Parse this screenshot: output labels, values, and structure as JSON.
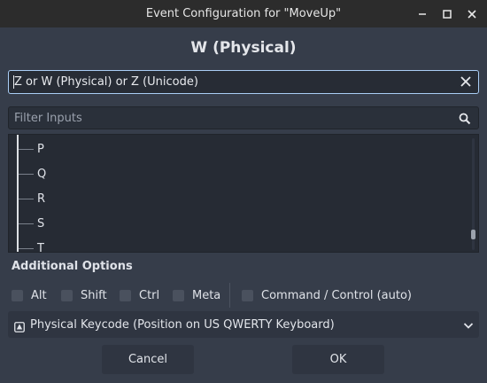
{
  "window": {
    "title": "Event Configuration for \"MoveUp\""
  },
  "heading": "W (Physical)",
  "event_field": {
    "value": "Z or W (Physical) or Z (Unicode)"
  },
  "filter": {
    "placeholder": "Filter Inputs"
  },
  "tree": {
    "items": [
      "P",
      "Q",
      "R",
      "S",
      "T"
    ]
  },
  "options": {
    "heading": "Additional Options",
    "modifiers": [
      {
        "label": "Alt",
        "checked": false
      },
      {
        "label": "Shift",
        "checked": false
      },
      {
        "label": "Ctrl",
        "checked": false
      },
      {
        "label": "Meta",
        "checked": false
      }
    ],
    "command_control": {
      "label": "Command / Control (auto)",
      "checked": false
    }
  },
  "keycode_select": {
    "selected": "Physical Keycode (Position on US QWERTY Keyboard)",
    "icon": "keyboard-physical-icon"
  },
  "buttons": {
    "cancel": "Cancel",
    "ok": "OK"
  },
  "colors": {
    "background": "#363d4a",
    "field_focus_border": "#a9cdf5",
    "titlebar": "#2c2c2c"
  }
}
